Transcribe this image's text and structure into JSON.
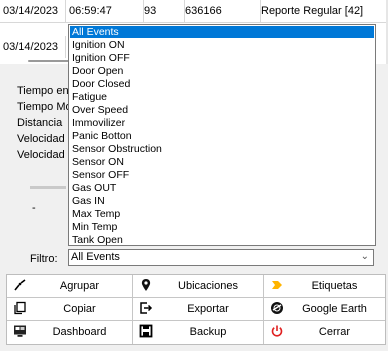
{
  "grid": {
    "rows": [
      [
        "03/14/2023",
        "06:59:47",
        "93",
        "636166",
        "Reporte Regular [42]"
      ],
      [
        "03/14/2023",
        "",
        "",
        "",
        ""
      ]
    ]
  },
  "stats": {
    "labels": [
      "Tiempo en",
      "Tiempo Mo",
      "Distancia",
      "Velocidad",
      "Velocidad"
    ]
  },
  "dash_text": "-",
  "filter": {
    "label": "Filtro:",
    "value": "All Events",
    "options": [
      "All Events",
      "Ignition ON",
      "Ignition OFF",
      "Door Open",
      "Door Closed",
      "Fatigue",
      "Over Speed",
      "Immovilizer",
      "Panic Botton",
      "Sensor Obstruction",
      "Sensor ON",
      "Sensor OFF",
      "Gas OUT",
      "Gas IN",
      "Max Temp",
      "Min Temp",
      "Tank Open"
    ],
    "selected_index": 0
  },
  "buttons": {
    "agrupar": "Agrupar",
    "ubicaciones": "Ubicaciones",
    "etiquetas": "Etiquetas",
    "copiar": "Copiar",
    "exportar": "Exportar",
    "google_earth": "Google Earth",
    "dashboard": "Dashboard",
    "backup": "Backup",
    "cerrar": "Cerrar"
  },
  "icons": {
    "agrupar": "agrupar-icon",
    "ubicaciones": "map-pin-icon",
    "etiquetas": "tag-arrow-icon",
    "copiar": "copy-icon",
    "exportar": "export-icon",
    "google_earth": "globe-icon",
    "dashboard": "dashboard-icon",
    "backup": "save-icon",
    "cerrar": "power-icon"
  },
  "colors": {
    "selection": "#0078d7",
    "etiquetas_icon": "#ffb400",
    "cerrar_icon": "#e02020"
  }
}
